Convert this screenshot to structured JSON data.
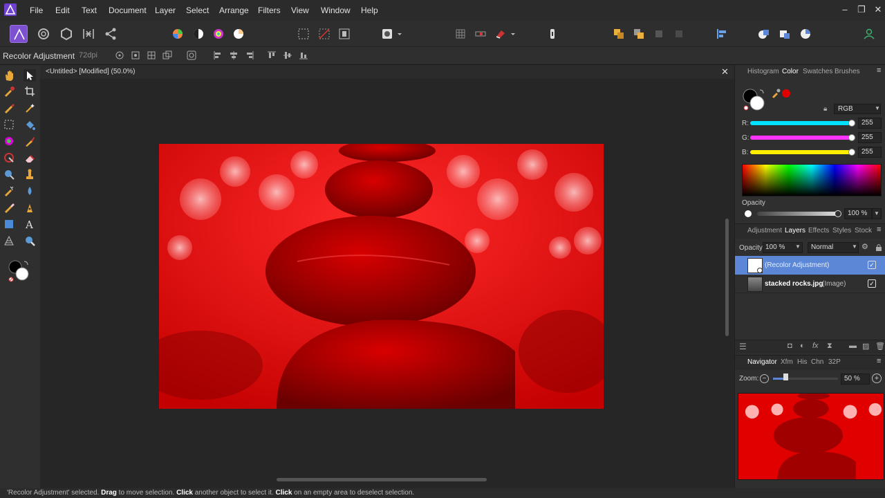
{
  "menu": {
    "items": [
      "File",
      "Edit",
      "Text",
      "Document",
      "Layer",
      "Select",
      "Arrange",
      "Filters",
      "View",
      "Window",
      "Help"
    ]
  },
  "context": {
    "tool_name": "Recolor Adjustment",
    "dpi": "72dpi"
  },
  "document": {
    "tab_title": "<Untitled> [Modified] (50.0%)"
  },
  "color_panel": {
    "tabs": [
      "Histogram",
      "Color",
      "Swatches",
      "Brushes"
    ],
    "active_tab": "Color",
    "mode": "RGB",
    "r": "255",
    "g": "255",
    "b": "255",
    "r_label": "R:",
    "g_label": "G:",
    "b_label": "B:",
    "opacity_label": "Opacity",
    "opacity": "100 %"
  },
  "layers_panel": {
    "tabs": [
      "Adjustment",
      "Layers",
      "Effects",
      "Styles",
      "Stock"
    ],
    "active_tab": "Layers",
    "opacity_label": "Opacity:",
    "opacity": "100 %",
    "blend_mode": "Normal",
    "layers": [
      {
        "name": "(Recolor Adjustment)",
        "type": "",
        "selected": true
      },
      {
        "name": "stacked rocks.jpg",
        "type": "(Image)",
        "selected": false
      }
    ]
  },
  "navigator_panel": {
    "tabs": [
      "Navigator",
      "Xfm",
      "His",
      "Chn",
      "32P"
    ],
    "active_tab": "Navigator",
    "zoom_label": "Zoom:",
    "zoom": "50 %"
  },
  "status": {
    "p1": "'Recolor Adjustment' selected. ",
    "b1": "Drag",
    "p2": " to move selection. ",
    "b2": "Click",
    "p3": " another object to select it. ",
    "b3": "Click",
    "p4": " on an empty area to deselect selection."
  },
  "colors": {
    "accent_selected": "#5b87d6",
    "photo_red": "#e00000",
    "affinity_purple": "#7d4fd1"
  }
}
